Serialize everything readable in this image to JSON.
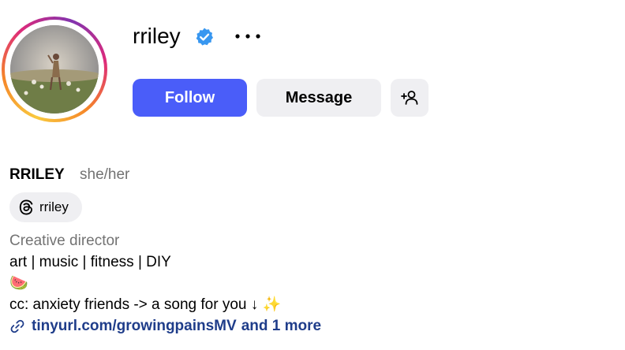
{
  "profile": {
    "username": "rriley",
    "verified": true,
    "accent_color": "#4a5df9",
    "verified_color": "#3897f0",
    "avatar_icon": "profile-photo"
  },
  "actions": {
    "follow_label": "Follow",
    "message_label": "Message",
    "add_user_icon": "add-user-icon",
    "more_icon": "more-options-icon"
  },
  "bio": {
    "full_name": "RRILEY",
    "pronouns": "she/her",
    "threads_handle": "rriley",
    "category": "Creative director",
    "line1": "art | music | fitness | DIY",
    "line2": "🍉",
    "line3": "cc: anxiety friends -> a song for you ↓ ✨",
    "link_text": "tinyurl.com/growingpainsMV",
    "link_more": "and 1 more",
    "link_color": "#1f3d8a"
  }
}
